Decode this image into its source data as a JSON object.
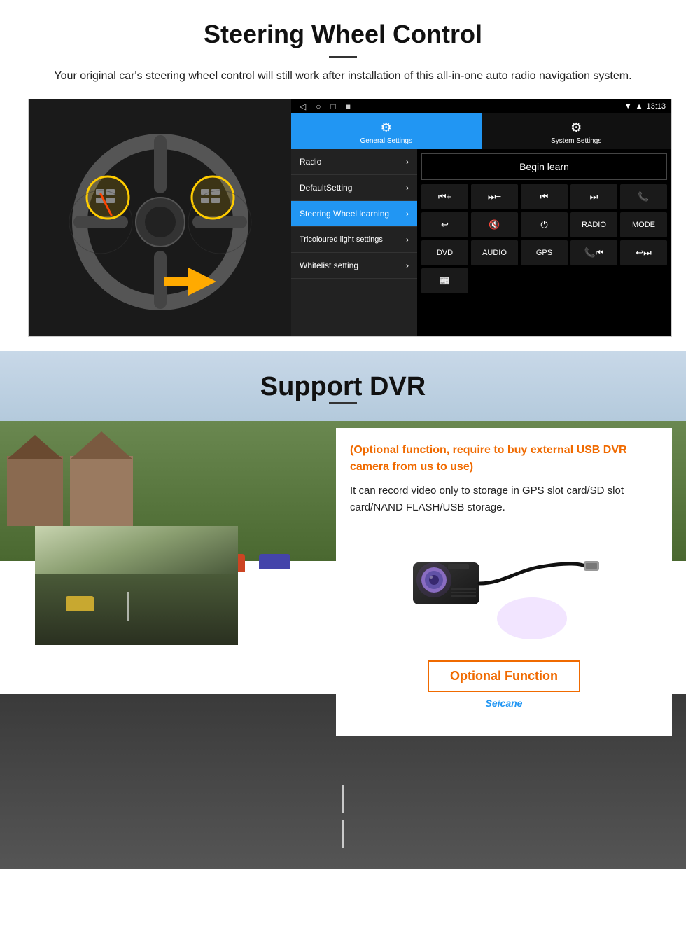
{
  "page": {
    "sections": {
      "steering": {
        "title": "Steering Wheel Control",
        "subtitle": "Your original car's steering wheel control will still work after installation of this all-in-one auto radio navigation system.",
        "android_ui": {
          "status_bar": {
            "time": "13:13",
            "nav_icons": [
              "◁",
              "○",
              "□",
              "■"
            ]
          },
          "tabs": [
            {
              "label": "General Settings",
              "icon": "⚙",
              "active": true
            },
            {
              "label": "System Settings",
              "icon": "🔧",
              "active": false
            }
          ],
          "menu_items": [
            {
              "label": "Radio",
              "active": false
            },
            {
              "label": "DefaultSetting",
              "active": false
            },
            {
              "label": "Steering Wheel learning",
              "active": true
            },
            {
              "label": "Tricoloured light settings",
              "active": false
            },
            {
              "label": "Whitelist setting",
              "active": false
            }
          ],
          "begin_learn_button": "Begin learn",
          "control_buttons": [
            "⏮+",
            "⏮-",
            "⏮⏮",
            "⏭⏭",
            "📞",
            "↩",
            "🔇x",
            "⏻",
            "RADIO",
            "MODE",
            "DVD",
            "AUDIO",
            "GPS",
            "📞⏮",
            "↩⏭",
            "📰"
          ]
        }
      },
      "dvr": {
        "title": "Support DVR",
        "optional_text": "(Optional function, require to buy external USB DVR camera from us to use)",
        "description": "It can record video only to storage in GPS slot card/SD slot card/NAND FLASH/USB storage.",
        "optional_function_label": "Optional Function",
        "brand": "Seicane"
      }
    }
  }
}
